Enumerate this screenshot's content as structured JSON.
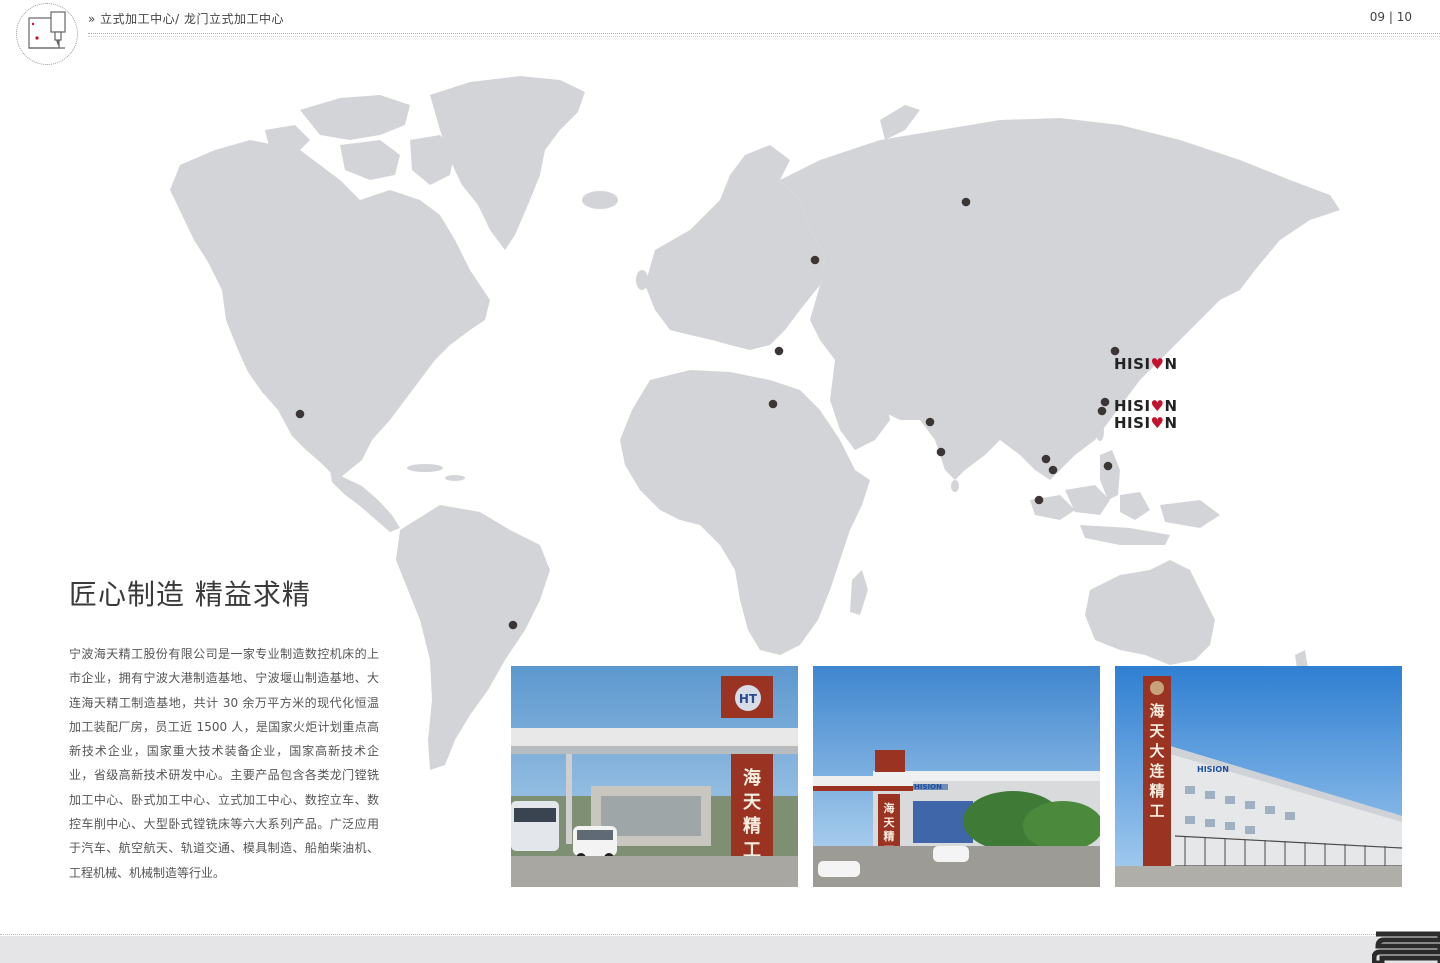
{
  "header": {
    "breadcrumb": "» 立式加工中心/ 龙门立式加工中心",
    "page_number": "09 | 10",
    "logo_icon": "machine-tool-icon"
  },
  "map": {
    "icon": "world-map",
    "land_color": "#d3d4d8",
    "dot_color": "#3b3536",
    "brand_labels": [
      "HISION",
      "HISION",
      "HISION"
    ],
    "brand_color": "#222222",
    "heart_color": "#c4122e"
  },
  "content": {
    "headline": "匠心制造 精益求精",
    "body": "宁波海天精工股份有限公司是一家专业制造数控机床的上市企业，拥有宁波大港制造基地、宁波堰山制造基地、大连海天精工制造基地，共计 30 余万平方米的现代化恒温加工装配厂房，员工近 1500 人，是国家火炬计划重点高新技术企业，国家重大技术装备企业，国家高新技术企业，省级高新技术研发中心。主要产品包含各类龙门镗铣加工中心、卧式加工中心、立式加工中心、数控立车、数控车削中心、大型卧式镗铣床等六大系列产品。广泛应用于汽车、航空航天、轨道交通、模具制造、船舶柴油机、工程机械、机械制造等行业。"
  },
  "photos": [
    {
      "name": "factory-gate-photo",
      "sign_logo": "HT",
      "sign_text": "海天精工"
    },
    {
      "name": "factory-building-photo",
      "sign_text": "海天精工",
      "wall_text": "HISION"
    },
    {
      "name": "dalian-factory-photo",
      "sign_text": "海天大连精工",
      "wall_text": "HISION"
    }
  ],
  "footer": {
    "mark_icon": "brand-mark-icon"
  }
}
